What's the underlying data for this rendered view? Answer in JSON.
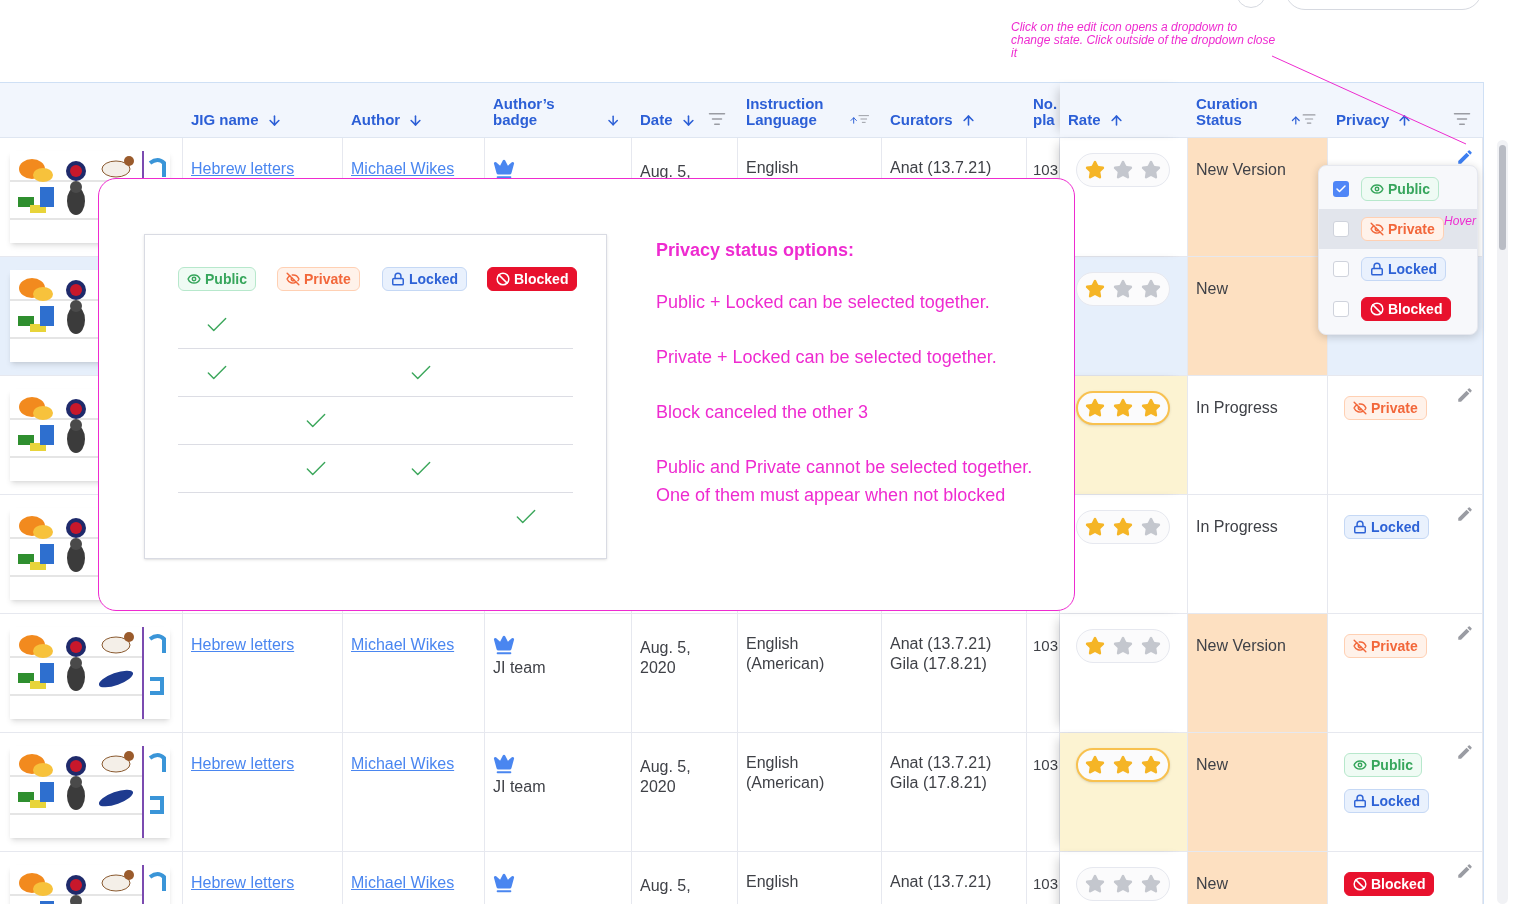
{
  "annotation": "Click on the edit icon opens a dropdown to change state. Click outside of the dropdown close it",
  "table": {
    "columns": [
      {
        "label": "JIG name",
        "ascending": false,
        "filter": false
      },
      {
        "label": "Author",
        "ascending": false,
        "filter": false
      },
      {
        "label": "Author’s badge",
        "ascending": false,
        "filter": false
      },
      {
        "label": "Date",
        "ascending": false,
        "filter": true
      },
      {
        "label": "Instruction Language",
        "ascending": true,
        "filter": true
      },
      {
        "label": "Curators",
        "ascending": true,
        "filter": false
      },
      {
        "label": "No. pla",
        "filter": false
      },
      {
        "label": "Rate",
        "ascending": true,
        "filter": false
      },
      {
        "label": "Curation Status",
        "ascending": true,
        "filter": true
      },
      {
        "label": "Privacy",
        "ascending": true,
        "filter": true
      }
    ],
    "rows": [
      {
        "selected": false,
        "jig_name": "Hebrew letters",
        "author": "Michael Wikes",
        "crown": true,
        "date": [
          "Aug. 5,"
        ],
        "language": [
          "English"
        ],
        "curators": [
          "Anat (13.7.21)"
        ],
        "plays": "103",
        "stars": 1,
        "status": {
          "text": "New Version",
          "color": "#fde0c1"
        },
        "privacy": [],
        "edit": {
          "active": true
        }
      },
      {
        "selected": true,
        "stars": 1,
        "status": {
          "text": "New",
          "color": "#fde0c1"
        },
        "privacy": []
      },
      {
        "selected": false,
        "stars": 3,
        "status": {
          "text": "In Progress",
          "color": "#ffffff"
        },
        "privacy": [
          {
            "kind": "private",
            "label": "Private"
          }
        ],
        "edit": {
          "active": false
        }
      },
      {
        "selected": false,
        "stars": 2,
        "status": {
          "text": "In Progress",
          "color": "#ffffff"
        },
        "privacy": [
          {
            "kind": "locked",
            "label": "Locked"
          }
        ],
        "edit": {
          "active": false
        }
      },
      {
        "selected": false,
        "jig_name": "Hebrew letters",
        "author": "Michael Wikes",
        "crown": true,
        "badge_text": "JI team",
        "date": [
          "Aug. 5,",
          "2020"
        ],
        "language": [
          "English",
          "(American)"
        ],
        "curators": [
          "Anat (13.7.21)",
          "Gila (17.8.21)"
        ],
        "plays": "103",
        "stars": 1,
        "status": {
          "text": "New Version",
          "color": "#fde0c1"
        },
        "privacy": [
          {
            "kind": "private",
            "label": "Private"
          }
        ],
        "edit": {
          "active": false
        }
      },
      {
        "selected": false,
        "jig_name": "Hebrew letters",
        "author": "Michael Wikes",
        "crown": true,
        "badge_text": "JI team",
        "date": [
          "Aug. 5,",
          "2020"
        ],
        "language": [
          "English",
          "(American)"
        ],
        "curators": [
          "Anat (13.7.21)",
          "Gila (17.8.21)"
        ],
        "plays": "103",
        "stars": 3,
        "status": {
          "text": "New",
          "color": "#fde0c1"
        },
        "privacy": [
          {
            "kind": "public",
            "label": "Public"
          },
          {
            "kind": "locked",
            "label": "Locked"
          }
        ],
        "edit": {
          "active": false
        }
      },
      {
        "selected": false,
        "jig_name": "Hebrew letters",
        "author": "Michael Wikes",
        "crown": true,
        "date": [
          "Aug. 5,"
        ],
        "language": [
          "English"
        ],
        "curators": [
          "Anat (13.7.21)"
        ],
        "plays": "103",
        "stars": 0,
        "status": {
          "text": "New",
          "color": "#fde0c1"
        },
        "privacy": [
          {
            "kind": "blocked",
            "label": "Blocked"
          }
        ],
        "edit": {
          "active": false
        }
      }
    ]
  },
  "dropdown": {
    "hover_note": "Hover",
    "items": [
      {
        "kind": "public",
        "label": "Public",
        "checked": true,
        "hovered": false
      },
      {
        "kind": "private",
        "label": "Private",
        "checked": false,
        "hovered": true
      },
      {
        "kind": "locked",
        "label": "Locked",
        "checked": false,
        "hovered": false
      },
      {
        "kind": "blocked",
        "label": "Blocked",
        "checked": false,
        "hovered": false
      }
    ]
  },
  "modal": {
    "matrix": {
      "columns": [
        {
          "kind": "public",
          "label": "Public"
        },
        {
          "kind": "private",
          "label": "Private"
        },
        {
          "kind": "locked",
          "label": "Locked"
        },
        {
          "kind": "blocked",
          "label": "Blocked"
        }
      ],
      "rows": [
        {
          "checks": [
            true,
            false,
            false,
            false
          ]
        },
        {
          "checks": [
            true,
            false,
            true,
            false
          ]
        },
        {
          "checks": [
            false,
            true,
            false,
            false
          ]
        },
        {
          "checks": [
            false,
            true,
            true,
            false
          ]
        },
        {
          "checks": [
            false,
            false,
            false,
            true
          ]
        }
      ]
    },
    "notes_title": "Privacy status options:",
    "notes": [
      [
        "Public + Locked can be selected together."
      ],
      [
        "Private + Locked can be selected together."
      ],
      [
        "Block canceled the other 3"
      ],
      [
        "Public and Private cannot be selected together.",
        "One of them must appear when not blocked"
      ]
    ]
  }
}
